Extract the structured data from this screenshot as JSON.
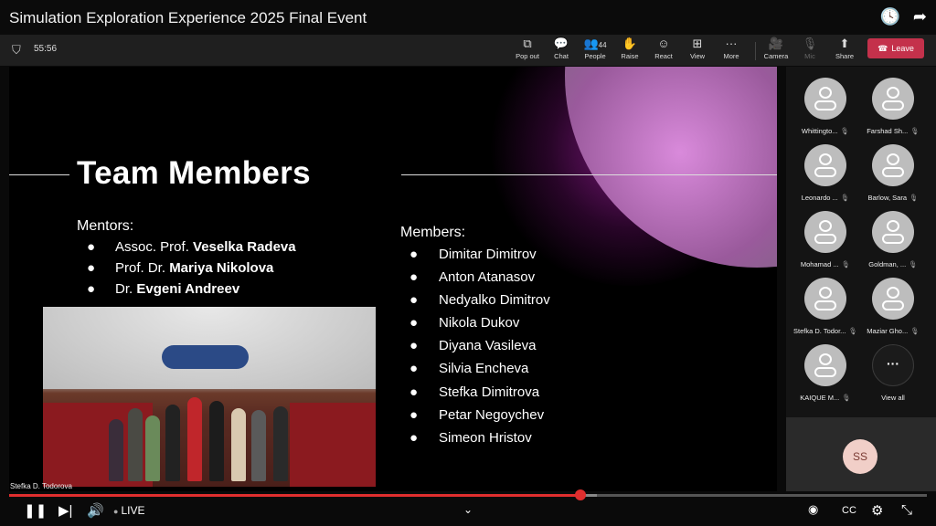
{
  "window": {
    "title": "Simulation Exploration Experience 2025 Final Event",
    "icons": [
      "clock-icon",
      "share-arrow-icon"
    ]
  },
  "meeting": {
    "timer": "55:56",
    "toolbar": [
      {
        "name": "pop-out",
        "label": "Pop out",
        "icon": "⧉"
      },
      {
        "name": "chat",
        "label": "Chat",
        "icon": "💬"
      },
      {
        "name": "people",
        "label": "People",
        "icon": "👥",
        "count": "44"
      },
      {
        "name": "raise",
        "label": "Raise",
        "icon": "✋"
      },
      {
        "name": "react",
        "label": "React",
        "icon": "☺"
      },
      {
        "name": "view",
        "label": "View",
        "icon": "⊞"
      },
      {
        "name": "more",
        "label": "More",
        "icon": "···"
      },
      {
        "name": "camera",
        "label": "Camera",
        "icon": "🎥"
      },
      {
        "name": "mic",
        "label": "Mic",
        "icon": "🎙"
      },
      {
        "name": "share",
        "label": "Share",
        "icon": "⬆"
      }
    ],
    "leave_label": "Leave",
    "leave_color": "#c4314b"
  },
  "slide": {
    "title": "Team Members",
    "mentors_heading": "Mentors:",
    "mentors": [
      {
        "prefix": "Assoc. Prof. ",
        "name": "Veselka Radeva"
      },
      {
        "prefix": "Prof. Dr. ",
        "name": "Mariya Nikolova"
      },
      {
        "prefix": "Dr. ",
        "name": "Evgeni Andreev"
      }
    ],
    "members_heading": "Members:",
    "members": [
      "Dimitar Dimitrov",
      "Anton Atanasov",
      "Nedyalko Dimitrov",
      "Nikola Dukov",
      "Diyana Vasileva",
      "Silvia Encheva",
      "Stefka Dimitrova",
      "Petar Negoychev",
      "Simeon Hristov"
    ],
    "bullet": "●",
    "presenter_caption": "Stefka D. Todorova"
  },
  "participants": {
    "tiles": [
      "Whittingto...",
      "Farshad Sh...",
      "Leonardo ...",
      "Barlow, Sara",
      "Mohamad ...",
      "Goldman, ...",
      "Stefka D. Todor...",
      "Maziar Gho...",
      "KAIQUE M..."
    ],
    "view_all_label": "View all",
    "self_initials": "SS"
  },
  "player": {
    "progress_fraction": 0.623,
    "live_label": "LIVE",
    "accent": "#e02e2e"
  }
}
